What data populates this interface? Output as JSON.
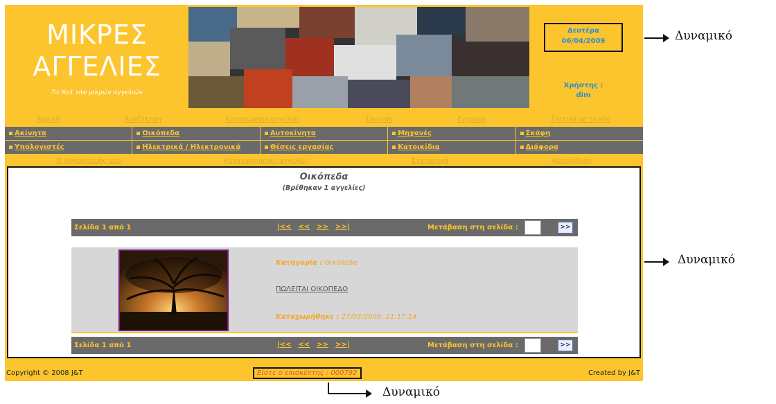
{
  "header": {
    "logo_line1": "ΜΙΚΡΕΣ",
    "logo_line2": "ΑΓΓΕΛΙΕΣ",
    "slogan": "Το No1 site μικρών αγγελιών",
    "day": "Δευτέρα",
    "date": "06/04/2009",
    "user_label": "Χρήστης :",
    "user_name": "dim"
  },
  "nav_top": [
    "Αρχική",
    "Αναζήτηση",
    "Καταχώρηση αγγελίας",
    "Σύνδεση",
    "Εγγραφή",
    "Σχετικά με το site"
  ],
  "categories_row1": [
    "Ακίνητα",
    "Οικόπεδα",
    "Αυτοκίνητα",
    "Μηχανές",
    "Σκάφη"
  ],
  "categories_row2": [
    "Υπολογιστές",
    "Ηλεκτρικά / Ηλεκτρονικά",
    "Θέσεις εργασίας",
    "Κατοικίδια",
    "Διάφορα"
  ],
  "nav_account": [
    "Ο λογαριασμός μου",
    "Καταχωρημένες αγγελίες",
    "Στατιστικά",
    "Αποσύνδεση"
  ],
  "main": {
    "title": "Οικόπεδα",
    "subtitle": "(Βρέθηκαν 1 αγγελίες)"
  },
  "pager": {
    "page_text": "Σελίδα 1 από 1",
    "first": "|<<",
    "prev": "<<",
    "next": ">>",
    "last": ">>|",
    "goto_label": "Μετάβαση στη σελίδα :",
    "goto_button": ">>"
  },
  "ad": {
    "category_label": "Κατηγορία :",
    "category_value": "Οικόπεδα",
    "ad_title": "ΠΩΛΕΙΤΑΙ ΟΙΚΟΠΕΔΟ",
    "posted_label": "Καταχωρήθηκε :",
    "posted_value": "27/03/2009, 21:17:14"
  },
  "footer": {
    "copyright": "Copyright © 2008 J&T",
    "visitor": "Είστε ο επισκέπτης : 000792",
    "created": "Created by J&T"
  },
  "annotations": {
    "top": "Δυναμικό",
    "middle": "Δυναμικό",
    "bottom": "Δυναμικό"
  },
  "colors": {
    "brand_yellow": "#fcc52e",
    "bar_gray": "#6a6a6a",
    "date_blue": "#2e8fd1",
    "accent_orange": "#f5a623"
  }
}
